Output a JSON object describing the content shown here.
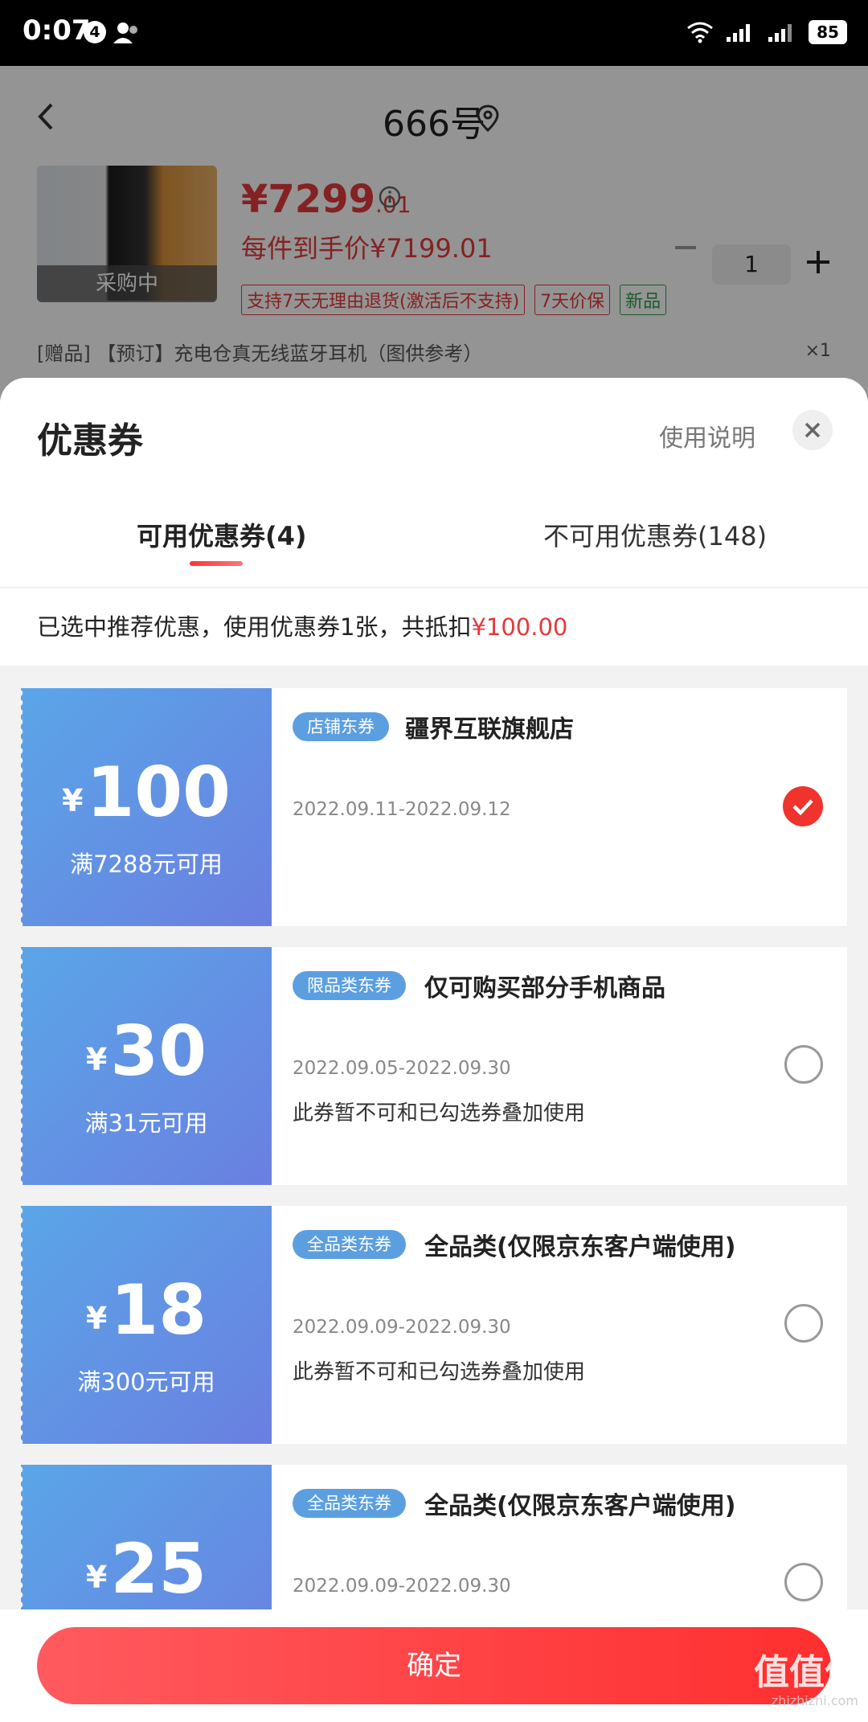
{
  "status_bar": {
    "time": "0:07",
    "notif_count": "4",
    "battery": "85"
  },
  "background_page": {
    "title": "666号",
    "image_label": "采购中",
    "price_main": "¥7299",
    "price_decimal": ".01",
    "unit_price": "每件到手价¥7199.01",
    "tags": [
      "支持7天无理由退货(激活后不支持)",
      "7天价保",
      "新品"
    ],
    "quantity": "1",
    "gift_text": "[赠品] 【预订】充电仓真无线蓝牙耳机（图供参考）",
    "gift_qty": "×1"
  },
  "sheet": {
    "title": "优惠券",
    "usage_link": "使用说明",
    "tabs": [
      {
        "label": "可用优惠券(4)",
        "active": true
      },
      {
        "label": "不可用优惠券(148)",
        "active": false
      }
    ],
    "notice_text": "已选中推荐优惠，使用优惠券1张，共抵扣",
    "notice_amount": "¥100.00"
  },
  "coupons": [
    {
      "yen": "¥",
      "amount": "100",
      "condition": "满7288元可用",
      "tag": "店铺东券",
      "title": "疆界互联旗舰店",
      "date": "2022.09.11-2022.09.12",
      "note": "",
      "selected": true
    },
    {
      "yen": "¥",
      "amount": "30",
      "condition": "满31元可用",
      "tag": "限品类东券",
      "title": "仅可购买部分手机商品",
      "date": "2022.09.05-2022.09.30",
      "note": "此券暂不可和已勾选券叠加使用",
      "selected": false
    },
    {
      "yen": "¥",
      "amount": "18",
      "condition": "满300元可用",
      "tag": "全品类东券",
      "title": "全品类(仅限京东客户端使用)",
      "date": "2022.09.09-2022.09.30",
      "note": "此券暂不可和已勾选券叠加使用",
      "selected": false
    },
    {
      "yen": "¥",
      "amount": "25",
      "condition": "",
      "tag": "全品类东券",
      "title": "全品类(仅限京东客户端使用)",
      "date": "2022.09.09-2022.09.30",
      "note": "",
      "selected": false
    }
  ],
  "footer": {
    "confirm_label": "确定",
    "watermark": "值值值",
    "watermark_sub": "zhizhizhi.com"
  },
  "colors": {
    "accent": "#e4393c",
    "coupon_blue": "#5c9fe0",
    "check_red": "#f0332c"
  }
}
